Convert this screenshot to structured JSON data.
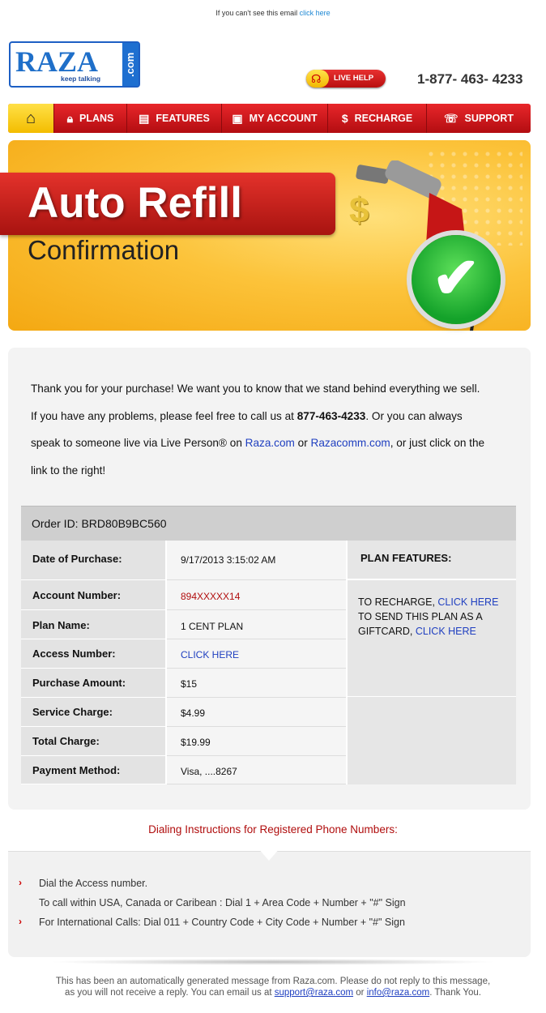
{
  "preheader": {
    "text": "If you can't see this email",
    "link": "click here"
  },
  "logo": {
    "word": "RAZA",
    "tagline": "keep talking",
    "suffix": ".com"
  },
  "live_help": {
    "label": "LIVE HELP"
  },
  "phone": "1-877- 463- 4233",
  "nav": {
    "home_icon": "home-icon",
    "items": [
      {
        "label": "PLANS",
        "icon": "lock-icon"
      },
      {
        "label": "FEATURES",
        "icon": "document-icon"
      },
      {
        "label": "MY ACCOUNT",
        "icon": "id-card-icon"
      },
      {
        "label": "RECHARGE",
        "icon": "money-bag-icon"
      },
      {
        "label": "SUPPORT",
        "icon": "phone-icon"
      }
    ]
  },
  "banner": {
    "title": "Auto Refill",
    "subtitle": "Confirmation"
  },
  "intro": {
    "line1": "Thank you for your purchase! We want you to know that we stand behind everything we sell.",
    "line2a": " If you have any problems, please feel free to call us at ",
    "line2b": "877-463-4233",
    "line2c": ". Or you can always",
    "line3a": "speak to someone live via Live Person® on ",
    "link1": "Raza.com",
    "or": " or ",
    "link2": "Razacomm.com",
    "line3b": ", or just click on the",
    "line4": "link to the right!"
  },
  "order": {
    "id_text": "Order ID: BRD80B9BC560",
    "rows": [
      {
        "label": "Date of Purchase:",
        "value": "9/17/2013 3:15:02 AM"
      },
      {
        "label": "Account Number:",
        "value": "894XXXXX14"
      },
      {
        "label": "Plan Name:",
        "value": "1 CENT PLAN"
      },
      {
        "label": "Access Number:",
        "value": "CLICK HERE"
      },
      {
        "label": "Purchase Amount:",
        "value": "$15"
      },
      {
        "label": "Service Charge:",
        "value": "$4.99"
      },
      {
        "label": "Total Charge:",
        "value": "$19.99"
      },
      {
        "label": "Payment Method:",
        "value": "Visa, ....8267"
      }
    ],
    "features_title": "PLAN FEATURES:",
    "features_recharge": "TO RECHARGE, ",
    "features_recharge_link": "CLICK HERE",
    "features_gift_a": "TO SEND THIS PLAN AS A",
    "features_gift_b": "GIFTCARD, ",
    "features_gift_link": "CLICK HERE"
  },
  "dialing": {
    "title": "Dialing Instructions for Registered Phone Numbers:",
    "item1": "Dial the Access number.",
    "item1_sub": "To call within USA, Canada or Caribean : Dial 1 + Area Code + Number + \"#\" Sign",
    "item2": "For International Calls: Dial 011 + Country Code + City Code + Number + \"#\" Sign"
  },
  "footer": {
    "line1": "This has been an automatically generated message from Raza.com. Please do not reply to this message,",
    "line2a": "as you will not receive a reply. You can email us at ",
    "email1": "support@raza.com",
    "or": " or ",
    "email2": "info@raza.com",
    "line2b": ". Thank You."
  }
}
